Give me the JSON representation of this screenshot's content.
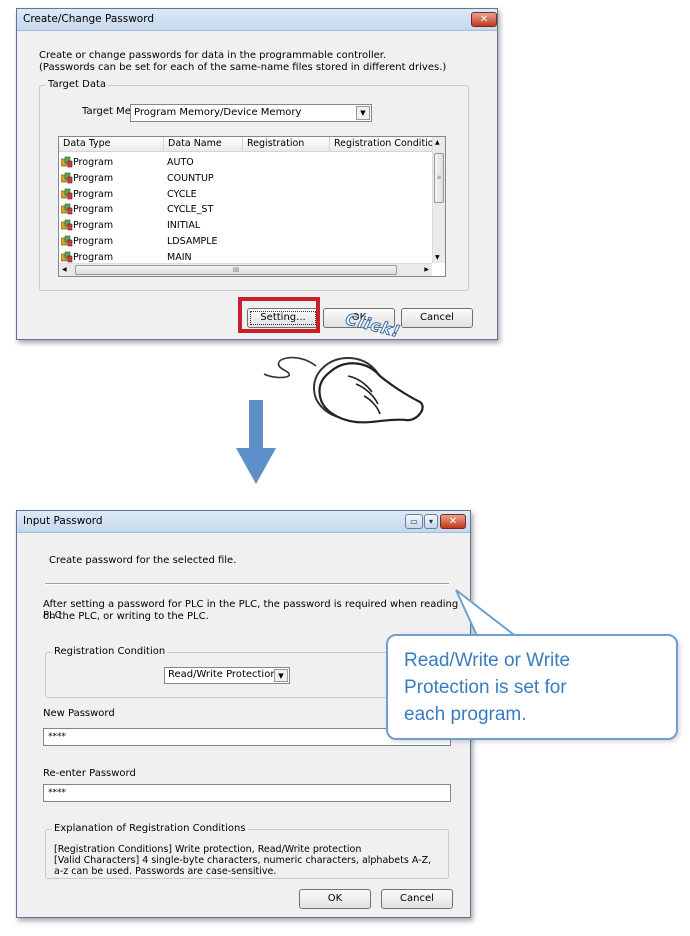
{
  "create_dialog": {
    "title": "Create/Change Password",
    "close_glyph": "✕",
    "description_line1": "Create or change passwords for data in the programmable controller.",
    "description_line2": "(Passwords can be set for each of the same-name files stored in different drives.)",
    "target_data_group": "Target Data",
    "target_memory_label": "Target Memory",
    "target_memory_value": "Program Memory/Device Memory",
    "columns": [
      "Data Type",
      "Data Name",
      "Registration",
      "Registration Condition"
    ],
    "rows": [
      {
        "type": "Program",
        "name": "AUTO"
      },
      {
        "type": "Program",
        "name": "COUNTUP"
      },
      {
        "type": "Program",
        "name": "CYCLE"
      },
      {
        "type": "Program",
        "name": "CYCLE_ST"
      },
      {
        "type": "Program",
        "name": "INITIAL"
      },
      {
        "type": "Program",
        "name": "LDSAMPLE"
      },
      {
        "type": "Program",
        "name": "MAIN"
      }
    ],
    "setting_button": "Setting...",
    "ok_button": "OK",
    "cancel_button": "Cancel",
    "hscroll_grip": "III"
  },
  "click_label": "Click!",
  "input_dialog": {
    "title": "Input Password",
    "close_glyph": "✕",
    "instruction": "Create password for the selected file.",
    "warning_line1": "After setting a password for PLC in the PLC, the password is required when reading PLC",
    "warning_line2": "on the PLC, or writing to the PLC.",
    "registration_condition_group": "Registration Condition",
    "registration_condition_value": "Read/Write Protection",
    "new_password_label": "New Password",
    "new_password_value": "****",
    "reenter_password_label": "Re-enter Password",
    "reenter_password_value": "****",
    "explanation_group": "Explanation of Registration Conditions",
    "explanation_line1": "[Registration Conditions] Write protection, Read/Write protection",
    "explanation_line2": "[Valid Characters] 4 single-byte characters, numeric characters, alphabets A-Z,",
    "explanation_line3": "a-z can be used. Passwords are case-sensitive.",
    "ok_button": "OK",
    "cancel_button": "Cancel"
  },
  "callout": {
    "line1": "Read/Write or Write",
    "line2": "Protection is set for",
    "line3": "each program."
  },
  "colors": {
    "highlight_box": "#c8202c",
    "arrow": "#5d8fc9",
    "callout_border": "#6f9fd0",
    "callout_text": "#3a7cc0"
  }
}
